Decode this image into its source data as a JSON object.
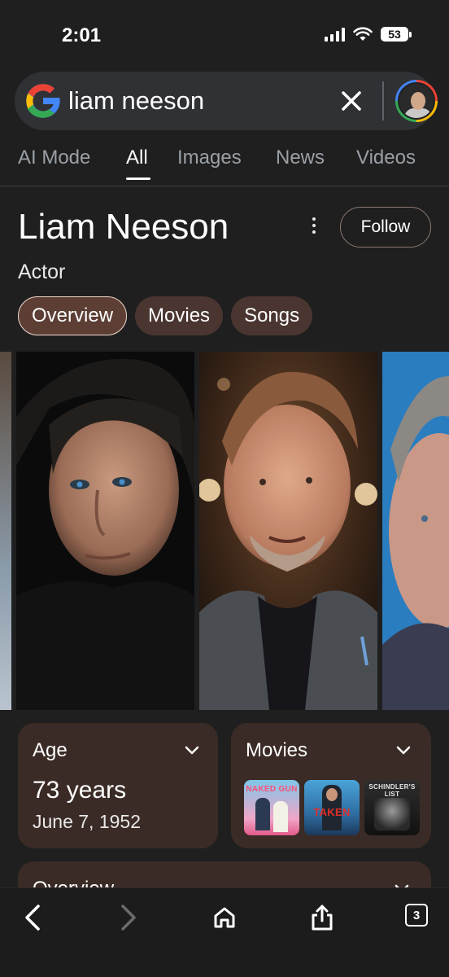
{
  "status_bar": {
    "time": "2:01",
    "battery": "53",
    "icons": [
      "signal-icon",
      "wifi-icon",
      "battery-icon"
    ]
  },
  "search": {
    "query": "liam neeson",
    "logo": "google-g-logo",
    "clear_icon": "close-icon",
    "avatar": "account-avatar"
  },
  "tabs": [
    {
      "label": "AI Mode",
      "active": false
    },
    {
      "label": "All",
      "active": true
    },
    {
      "label": "Images",
      "active": false
    },
    {
      "label": "News",
      "active": false
    },
    {
      "label": "Videos",
      "active": false
    }
  ],
  "entity": {
    "name": "Liam Neeson",
    "subtitle": "Actor",
    "follow_label": "Follow",
    "chips": [
      {
        "label": "Overview",
        "active": true
      },
      {
        "label": "Movies",
        "active": false
      },
      {
        "label": "Songs",
        "active": false
      }
    ]
  },
  "photos": [
    "photo-partial-left",
    "photo-portrait-dark",
    "photo-event-smiling",
    "photo-partial-right"
  ],
  "cards": {
    "age": {
      "title": "Age",
      "value": "73 years",
      "date": "June 7, 1952"
    },
    "movies": {
      "title": "Movies",
      "posters": [
        {
          "label": "NAKED GUN"
        },
        {
          "label": "TAKEN"
        },
        {
          "label": "SCHINDLER'S LIST"
        }
      ]
    },
    "overview": {
      "title": "Overview"
    }
  },
  "toolbar": {
    "tab_count": "3",
    "icons": [
      "back-icon",
      "forward-icon",
      "home-icon",
      "share-icon",
      "tabs-icon"
    ]
  },
  "colors": {
    "background": "#1f1f1f",
    "card": "#3b2b26",
    "chip": "#4a3530",
    "accent_text": "#ffffff"
  }
}
